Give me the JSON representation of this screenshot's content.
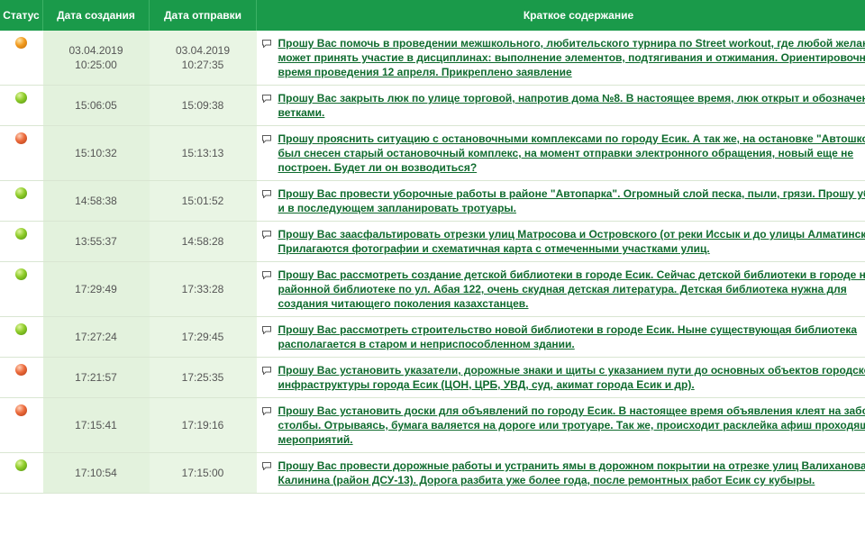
{
  "headers": {
    "status": "Статус",
    "created": "Дата создания",
    "sent": "Дата отправки",
    "summary": "Краткое содержание"
  },
  "rows": [
    {
      "status": "orange",
      "created_date": "03.04.2019",
      "created_time": "10:25:00",
      "sent_date": "03.04.2019",
      "sent_time": "10:27:35",
      "summary": "Прошу Вас помочь в проведении межшкольного, любительского турнира по Street workout, где любой желающий может принять участие в дисциплинах: выполнение элементов, подтягивания и отжимания. Ориентировочное время проведения 12 апреля. Прикреплено заявление"
    },
    {
      "status": "green",
      "created_date": "",
      "created_time": "15:06:05",
      "sent_date": "",
      "sent_time": "15:09:38",
      "summary": "Прошу Вас закрыть люк по улице торговой, напротив дома №8. В настоящее время, люк открыт и обозначен ветками."
    },
    {
      "status": "red",
      "created_date": "",
      "created_time": "15:10:32",
      "sent_date": "",
      "sent_time": "15:13:13",
      "summary": "Прошу прояснить ситуацию с остановочными комплексами по городу Есик. А так же, на остановке \"Автошкола\" был снесен старый остановочный комплекс, на момент отправки электронного обращения, новый еще не построен. Будет ли он возводиться?"
    },
    {
      "status": "green",
      "created_date": "",
      "created_time": "14:58:38",
      "sent_date": "",
      "sent_time": "15:01:52",
      "summary": "Прошу Вас провести уборочные работы в районе \"Автопарка\". Огромный слой песка, пыли, грязи. Прошу убрать и в последующем запланировать тротуары."
    },
    {
      "status": "green",
      "created_date": "",
      "created_time": "13:55:37",
      "sent_date": "",
      "sent_time": "14:58:28",
      "summary": "Прошу Вас заасфальтировать отрезки улиц Матросова и Островского (от реки Иссык и до улицы Алматинской). Прилагаются фотографии и схематичная карта с отмеченными участками улиц."
    },
    {
      "status": "green",
      "created_date": "",
      "created_time": "17:29:49",
      "sent_date": "",
      "sent_time": "17:33:28",
      "summary": "Прошу Вас рассмотреть создание детской библиотеки в городе Есик. Сейчас детской библиотеки в городе нет. В районной библиотеке по ул. Абая 122, очень скудная детская литература. Детская библиотека нужна для создания читающего поколения казахстанцев."
    },
    {
      "status": "green",
      "created_date": "",
      "created_time": "17:27:24",
      "sent_date": "",
      "sent_time": "17:29:45",
      "summary": "Прошу Вас рассмотреть строительство новой библиотеки в городе Есик. Ныне существующая библиотека располагается в старом и неприспособленном здании."
    },
    {
      "status": "red",
      "created_date": "",
      "created_time": "17:21:57",
      "sent_date": "",
      "sent_time": "17:25:35",
      "summary": "Прошу Вас установить указатели, дорожные знаки и щиты с указанием пути до основных объектов городской инфраструктуры города Есик (ЦОН, ЦРБ, УВД, суд, акимат города Есик и др)."
    },
    {
      "status": "red",
      "created_date": "",
      "created_time": "17:15:41",
      "sent_date": "",
      "sent_time": "17:19:16",
      "summary": "Прошу Вас установить доски для объявлений по городу Есик. В настоящее время объявления клеят на заборы и столбы. Отрываясь, бумага валяется на дороге или тротуаре. Так же, происходит расклейка афиш проходящих мероприятий."
    },
    {
      "status": "green",
      "created_date": "",
      "created_time": "17:10:54",
      "sent_date": "",
      "sent_time": "17:15:00",
      "summary": "Прошу Вас провести дорожные работы и устранить ямы в дорожном покрытии на отрезке улиц Валиханова и Калинина (район ДСУ-13). Дорога разбита уже более года, после ремонтных работ Есик су кубыры."
    }
  ]
}
